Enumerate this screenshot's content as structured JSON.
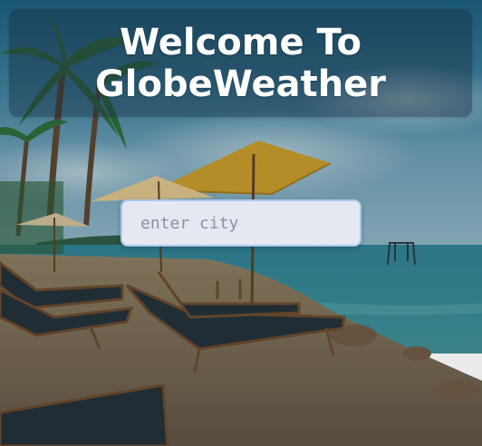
{
  "app": {
    "title_line1": "Welcome To",
    "title_line2": "GlobeWeather"
  },
  "search": {
    "placeholder": "enter city",
    "value": ""
  },
  "background": {
    "description_icon": "beach-photo"
  }
}
